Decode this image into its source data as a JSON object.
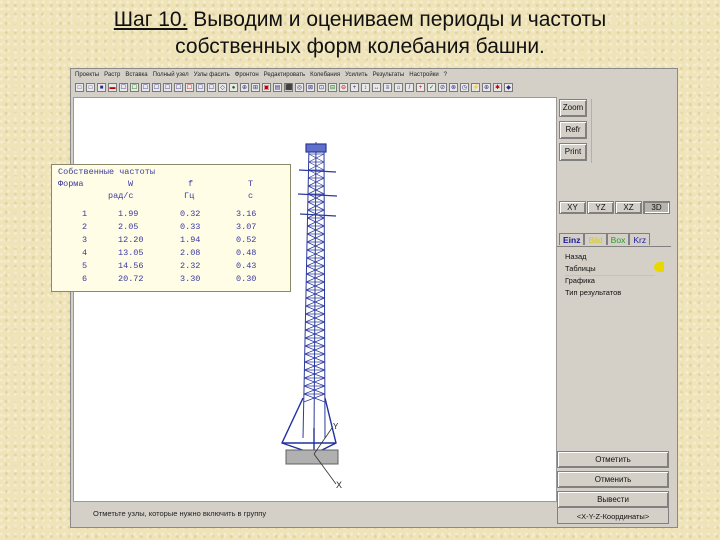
{
  "slide": {
    "title_step": "Шаг 10.",
    "title_line1_rest": " Выводим и оцениваем периоды и частоты",
    "title_line2": "собственных форм колебания башни."
  },
  "menu": [
    "Проекты",
    "Растр",
    "Вставка",
    "Полный узел",
    "Узлы фасить",
    "Фронтон",
    "Редактировать",
    "Колебания",
    "Усилить",
    "Результаты",
    "Настройки",
    "?"
  ],
  "toolbar_icons": [
    "□",
    "□",
    "■",
    "▬",
    "☐",
    "☐",
    "☐",
    "☐",
    "☐",
    "☐",
    "☐",
    "☐",
    "☐",
    "◇",
    "●",
    "⊕",
    "⊞",
    "▣",
    "▤",
    "⬛",
    "◎",
    "⊠",
    "⊡",
    "⊟",
    "⊖",
    "+",
    "↕",
    "↔",
    "≡",
    "⌂",
    "/",
    "+",
    "✓",
    "⊘",
    "⊗",
    "◷",
    "⚡",
    "⊕",
    "✱",
    "◆"
  ],
  "freq_table": {
    "title": "Собственные частоты",
    "header1": [
      "Форма",
      "W",
      "f",
      "T"
    ],
    "header2": [
      "",
      "рад/с",
      "Гц",
      "с"
    ],
    "rows": [
      [
        "1",
        "1.99",
        "0.32",
        "3.16"
      ],
      [
        "2",
        "2.05",
        "0.33",
        "3.07"
      ],
      [
        "3",
        "12.20",
        "1.94",
        "0.52"
      ],
      [
        "4",
        "13.05",
        "2.08",
        "0.48"
      ],
      [
        "5",
        "14.56",
        "2.32",
        "0.43"
      ],
      [
        "6",
        "20.72",
        "3.30",
        "0.30"
      ]
    ]
  },
  "canvas": {
    "axis_x": "X",
    "axis_y": "Y"
  },
  "side": {
    "zoom": "Zoom",
    "refr": "Refr",
    "print": "Print",
    "views": [
      "XY",
      "YZ",
      "XZ",
      "3D"
    ],
    "tabs": [
      "Einz",
      "Bild",
      "Box",
      "Krz"
    ],
    "menu_items": [
      "Назад",
      "Таблицы",
      "Графика",
      "Тип результатов"
    ],
    "mark": "Отметить",
    "cancel": "Отменить",
    "output": "Вывести",
    "coord": "<X-Y-Z-Координаты>"
  },
  "status": "Отметьте узлы, которые нужно включить в группу"
}
